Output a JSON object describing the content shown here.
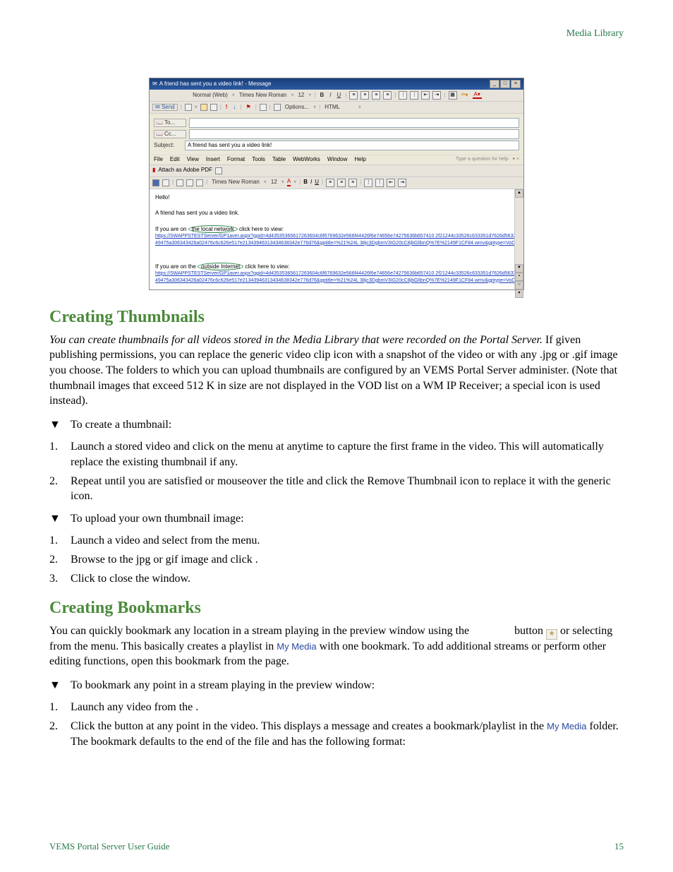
{
  "header": {
    "section": "Media Library"
  },
  "screenshot": {
    "title": "A friend has sent you a video link! - Message",
    "toolbar1": {
      "style": "Normal (Web)",
      "font": "Times New Roman",
      "size": "12"
    },
    "toolbar_send": "Send",
    "toolbar_options": "Options...",
    "toolbar_html": "HTML",
    "fields": {
      "to": "To...",
      "cc": "Cc...",
      "subject_label": "Subject:",
      "subject_value": "A friend has sent you a video link!"
    },
    "menu": {
      "items": [
        "File",
        "Edit",
        "View",
        "Insert",
        "Format",
        "Tools",
        "Table",
        "WebWorks",
        "Window",
        "Help"
      ],
      "help_prompt": "Type a question for help"
    },
    "attach_pdf": "Attach as Adobe PDF",
    "body": {
      "greeting": "Hello!",
      "line1": "A friend has sent you a video link.",
      "local_intro_pre": "If you are on ",
      "local_intro_circ": "the local network",
      "local_intro_post": " click here to view:",
      "url1": "https://SWAPPSTESTServer/GP1aver.aspx?ggid=4d43535365617263604c6f6769632e566f44426f6e74656e74275636b657410 2f21244c33526c633351d7626d563349475a306343426a02476c6c626e517e21343946313434638342e776d76&gptitle=%21%24L 38jc3DgbmV3IG20cC8jbGlIbnQ%7E%2149F1CF84.wmv&gptype=VoD",
      "ext_intro_pre": "If you are on the ",
      "ext_intro_circ": "outside Internet",
      "ext_intro_post": " click here to view:",
      "url2": "https://SWAPPSTESTServer/GP1aver.aspx?ggid=4d43535365617263604c6f6769632e566f44426f6e74656e74275636b657410 2f21244c33526c633351d7626d563349475a306343426a02476c6c626e517e21343946313434638342e776d76&gptitle=%21%24L 38jc3DgbmV3IG20cC8jbGlIbnQ%7E%2149F1CF84.wmv&gptype=VoD"
    }
  },
  "section_thumbs": {
    "heading": "Creating Thumbnails",
    "intro_italic": "You can create thumbnails for all videos stored in the Media Library that were recorded on the Portal Server.",
    "intro_rest": " If given publishing permissions, you can replace the generic video clip icon with a snapshot of the video or with any .jpg or .gif image you choose. The folders to which you can upload thumbnails are configured by an VEMS Portal Server administer. (Note that thumbnail images that exceed 512 K in size are not displayed in the VOD list on a WM IP Receiver; a special icon is used instead).",
    "proc1_title": "To create a thumbnail:",
    "proc1_steps": [
      "Launch a stored video and click                               on the                menu at anytime to capture the first frame in the video. This will automatically replace the existing thumbnail if any.",
      "Repeat until you are satisfied or mouseover the title and click the Remove Thumbnail icon to replace it with the generic icon."
    ],
    "proc2_title": "To upload your own thumbnail image:",
    "proc2_steps": [
      "Launch a video and select                               from the                menu.",
      "Browse to the jpg or gif image and click                  .",
      "Click            to close the window."
    ]
  },
  "section_bookmarks": {
    "heading": "Creating Bookmarks",
    "p1_a": "You can quickly bookmark any location in a stream playing in the preview window using the ",
    "p1_b": "button ",
    "p1_c": " or selecting                               from the                menu. This basically creates a playlist in ",
    "p1_mymedia": "My Media",
    "p1_d": " with one bookmark. To add additional streams or perform other editing functions, open this bookmark from the                   page.",
    "proc_title": "To bookmark any point in a stream playing in the preview window:",
    "steps": {
      "s1": "Launch any video from the                       .",
      "s2_a": "Click the                   button at any point in the video. This displays a message and creates a bookmark/playlist in the ",
      "s2_mymedia": "My Media",
      "s2_b": " folder. The bookmark defaults to the end of the file and has the following format:"
    }
  },
  "footer": {
    "left": "VEMS Portal Server User Guide",
    "right": "15"
  }
}
